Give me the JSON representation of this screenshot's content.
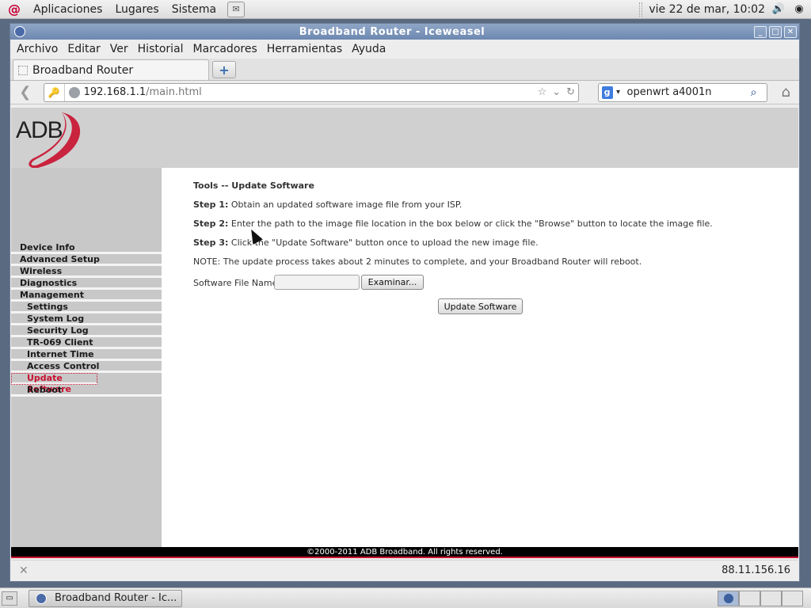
{
  "top_panel": {
    "menus": [
      "Aplicaciones",
      "Lugares",
      "Sistema"
    ],
    "clock": "vie 22 de mar, 10:02"
  },
  "window": {
    "title": "Broadband Router - Iceweasel"
  },
  "menubar": {
    "items": [
      "Archivo",
      "Editar",
      "Ver",
      "Historial",
      "Marcadores",
      "Herramientas",
      "Ayuda"
    ]
  },
  "tabs": [
    {
      "label": "Broadband Router"
    }
  ],
  "navbar": {
    "url_host": "192.168.1.1",
    "url_path": "/main.html",
    "search_value": "openwrt a4001n"
  },
  "page": {
    "logo_text": "ADB",
    "nav": [
      {
        "label": "Device Info",
        "sub": false,
        "active": false
      },
      {
        "label": "Advanced Setup",
        "sub": false,
        "active": false
      },
      {
        "label": "Wireless",
        "sub": false,
        "active": false
      },
      {
        "label": "Diagnostics",
        "sub": false,
        "active": false
      },
      {
        "label": "Management",
        "sub": false,
        "active": false
      },
      {
        "label": "Settings",
        "sub": true,
        "active": false
      },
      {
        "label": "System Log",
        "sub": true,
        "active": false
      },
      {
        "label": "Security Log",
        "sub": true,
        "active": false
      },
      {
        "label": "TR-069 Client",
        "sub": true,
        "active": false
      },
      {
        "label": "Internet Time",
        "sub": true,
        "active": false
      },
      {
        "label": "Access Control",
        "sub": true,
        "active": false
      },
      {
        "label": "Update Software",
        "sub": true,
        "active": true
      },
      {
        "label": "Reboot",
        "sub": true,
        "active": false
      }
    ],
    "title": "Tools -- Update Software",
    "step1_label": "Step 1:",
    "step1_text": " Obtain an updated software image file from your ISP.",
    "step2_label": "Step 2:",
    "step2_text": " Enter the path to the image file location in the box below or click the \"Browse\" button to locate the image file.",
    "step3_label": "Step 3:",
    "step3_text": " Click the \"Update Software\" button once to upload the new image file.",
    "note": "NOTE: The update process takes about 2 minutes to complete, and your Broadband Router will reboot.",
    "file_label": "Software File Name:",
    "file_value": "",
    "browse_label": "Examinar...",
    "update_label": "Update Software",
    "footer": "©2000-2011 ADB Broadband. All rights reserved."
  },
  "statusbar": {
    "ip": "88.11.156.16"
  },
  "bottom_panel": {
    "task_label": "Broadband Router - Ic..."
  }
}
